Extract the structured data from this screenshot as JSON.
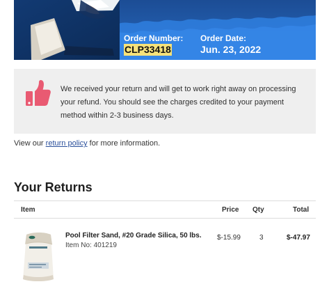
{
  "header": {
    "order_number_label": "Order Number:",
    "order_number": "CLP33418",
    "order_date_label": "Order Date:",
    "order_date": "Jun. 23, 2022"
  },
  "notice": {
    "icon": "thumbs-up-icon",
    "message": "We received your return and will get to work right away on processing your refund. You should see the charges credited to your payment method within 2-3 business days."
  },
  "policy": {
    "prefix": "View our",
    "link_text": "return policy",
    "suffix": "for more information."
  },
  "returns": {
    "title": "Your Returns",
    "columns": {
      "item": "Item",
      "price": "Price",
      "qty": "Qty",
      "total": "Total"
    },
    "items": [
      {
        "name": "Pool Filter Sand, #20 Grade Silica, 50 lbs.",
        "item_no": "Item No: 401219",
        "price": "$-15.99",
        "qty": "3",
        "total": "$-47.97",
        "image_icon": "sand-bag-icon"
      }
    ]
  },
  "colors": {
    "banner_blue": "#2a63b4",
    "highlight": "#f6e27a",
    "notice_bg": "#efefef",
    "thumb_pink": "#e95a72",
    "link_blue": "#2a4f9b"
  }
}
